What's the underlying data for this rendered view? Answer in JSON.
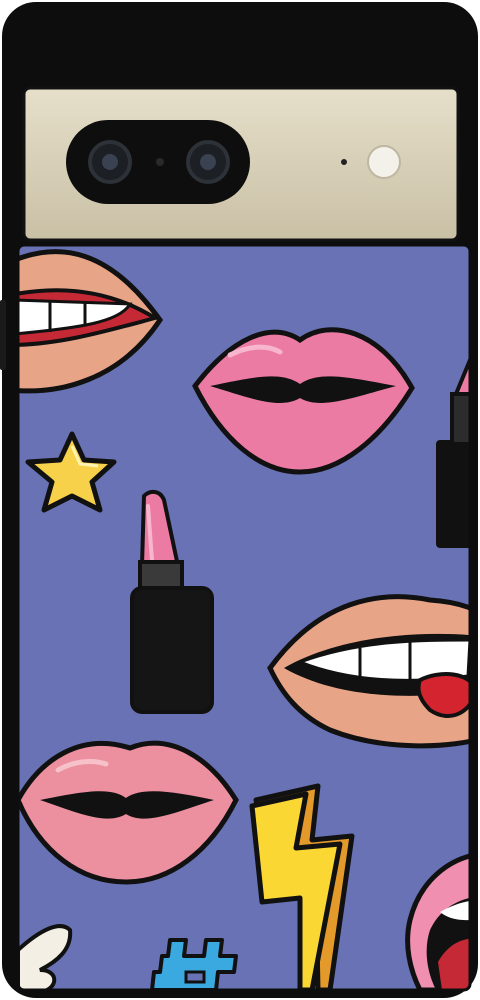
{
  "product": {
    "kind": "phone-case",
    "case_color": "#0d0d0d",
    "camera_bar_color": "#d9d2bb",
    "background_color": "#6872b4",
    "pattern_icons": [
      "lips-icon",
      "lipstick-icon",
      "star-icon",
      "lightning-bolt-icon",
      "angel-wing-icon",
      "hashtag-icon"
    ]
  }
}
